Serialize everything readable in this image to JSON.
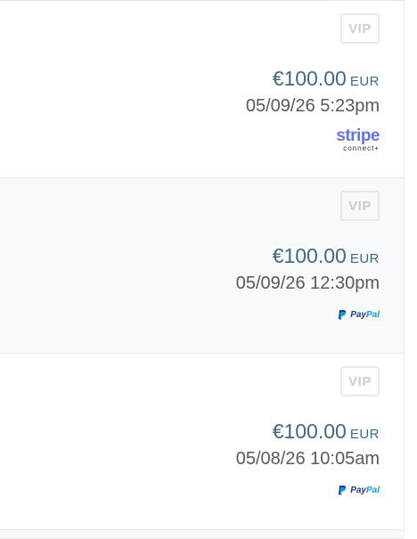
{
  "transactions": [
    {
      "badge": "VIP",
      "amount": "€100.00",
      "currency": "EUR",
      "datetime": "05/09/26 5:23pm",
      "payment_method": {
        "name": "stripe",
        "subtitle": "connect+"
      }
    },
    {
      "badge": "VIP",
      "amount": "€100.00",
      "currency": "EUR",
      "datetime": "05/09/26 12:30pm",
      "payment_method": {
        "name_a": "Pay",
        "name_b": "Pal"
      }
    },
    {
      "badge": "VIP",
      "amount": "€100.00",
      "currency": "EUR",
      "datetime": "05/08/26 10:05am",
      "payment_method": {
        "name_a": "Pay",
        "name_b": "Pal"
      }
    }
  ],
  "colors": {
    "amount": "#3f6a86",
    "stripe": "#6772e5",
    "paypal_dark": "#253b80",
    "paypal_light": "#179bd7"
  },
  "icons": [
    "paypal-logo-icon",
    "stripe-connect-logo"
  ]
}
